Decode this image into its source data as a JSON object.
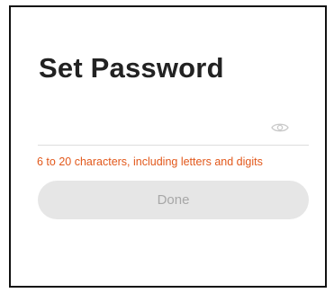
{
  "page": {
    "title": "Set Password"
  },
  "password_field": {
    "value": "",
    "placeholder": "",
    "visibility_toggle_icon": "eye-icon"
  },
  "hint": {
    "text": "6 to 20 characters, including letters and digits",
    "color": "#e2581b"
  },
  "done_button": {
    "label": "Done",
    "state": "disabled"
  }
}
